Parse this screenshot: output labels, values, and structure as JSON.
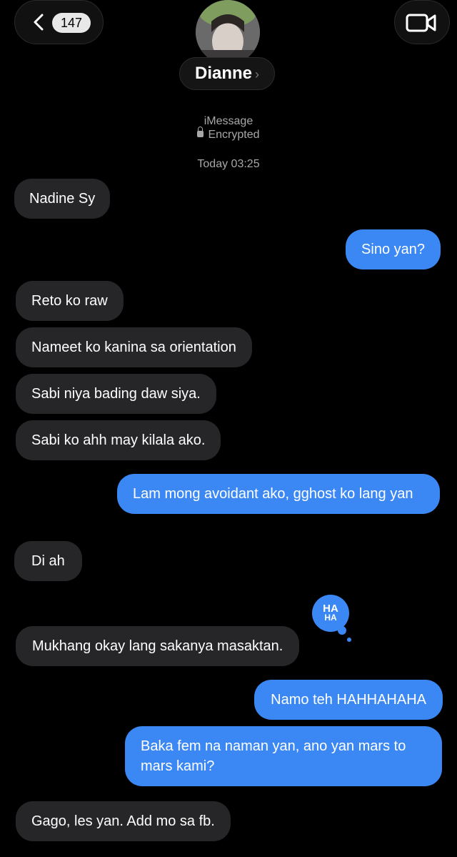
{
  "header": {
    "unread_count": "147",
    "contact_name": "Dianne",
    "service": "iMessage",
    "encryption": "Encrypted",
    "timestamp": "Today 03:25"
  },
  "messages": [
    {
      "dir": "in",
      "text": "Nadine Sy"
    },
    {
      "dir": "out",
      "text": "Sino yan?"
    },
    {
      "dir": "in",
      "text": "Reto ko raw"
    },
    {
      "dir": "in",
      "text": "Nameet ko kanina sa orientation"
    },
    {
      "dir": "in",
      "text": "Sabi niya bading daw siya."
    },
    {
      "dir": "in",
      "text": "Sabi ko ahh may kilala ako."
    },
    {
      "dir": "out",
      "text": "Lam mong avoidant ako, gghost ko lang yan"
    },
    {
      "dir": "in",
      "text": "Di ah"
    },
    {
      "dir": "in",
      "text": "Mukhang okay lang sakanya masaktan."
    },
    {
      "dir": "out",
      "text": "Namo teh HAHHAHAHA"
    },
    {
      "dir": "out",
      "text": "Baka fem na naman yan, ano yan mars to mars kami?"
    },
    {
      "dir": "in",
      "text": "Gago, les yan. Add mo sa fb."
    }
  ],
  "tapback": {
    "line1": "HA",
    "line2": "HA"
  },
  "colors": {
    "outgoing": "#3b88f5",
    "incoming": "#262628",
    "background": "#000000"
  }
}
